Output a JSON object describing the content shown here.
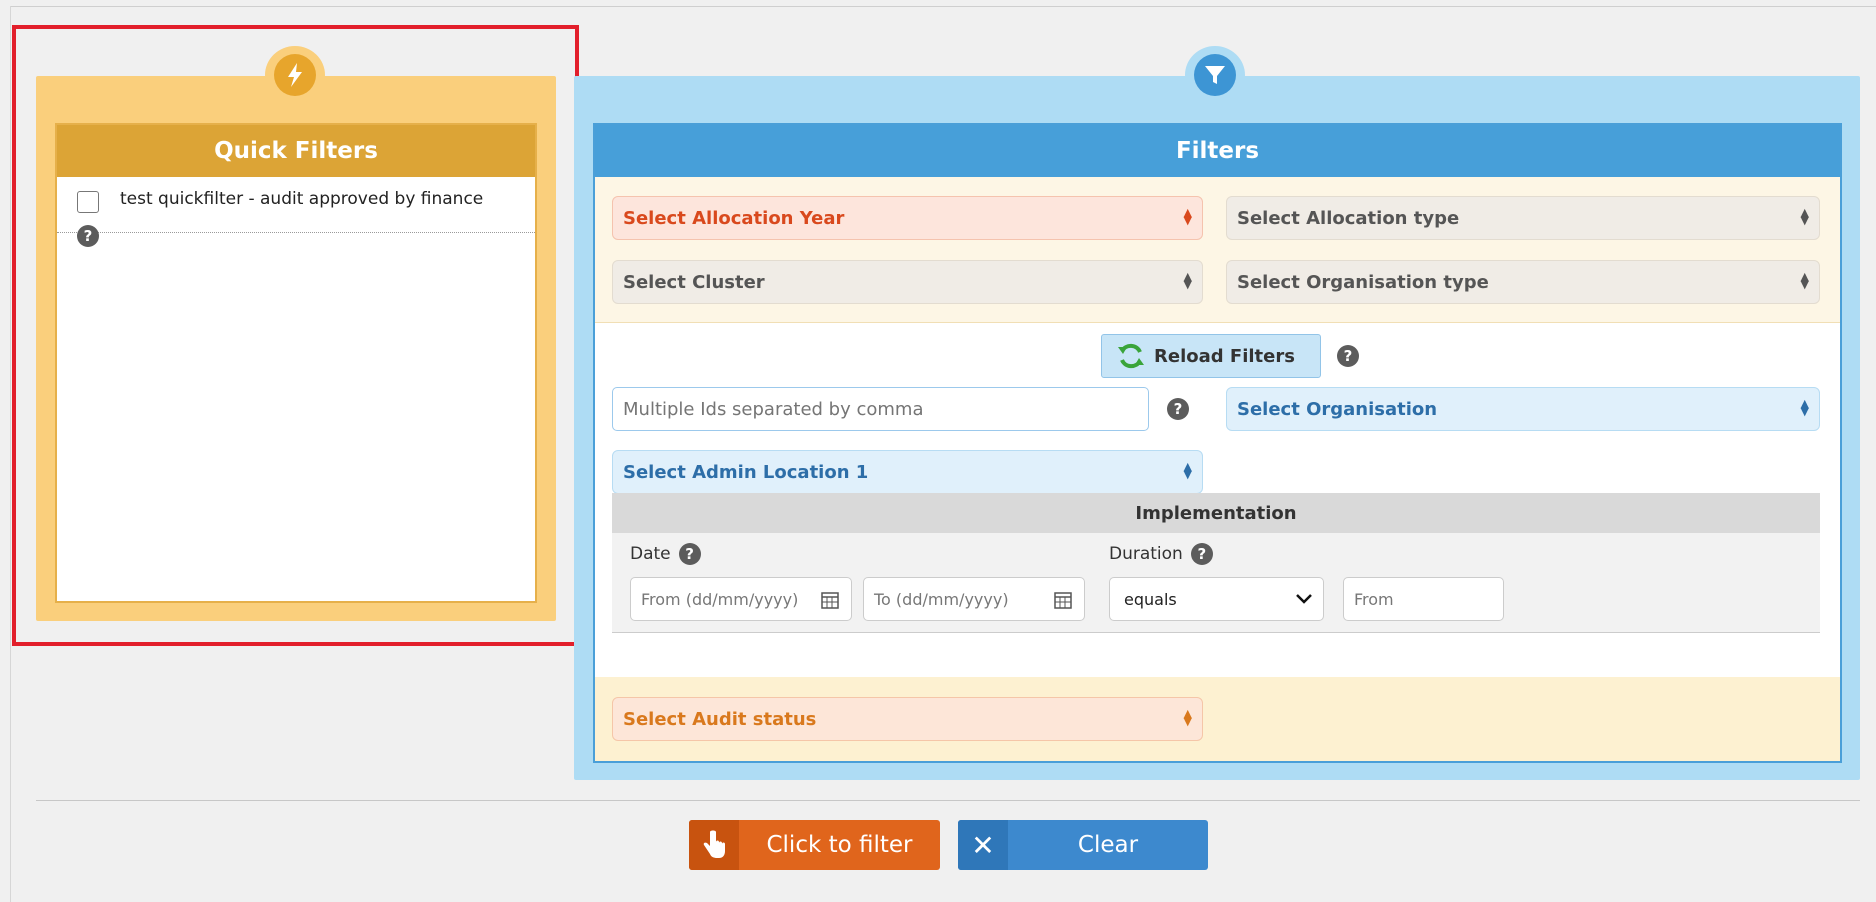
{
  "quick_filters": {
    "title": "Quick Filters",
    "items": [
      {
        "label": "test quickfilter - audit approved by finance",
        "checked": false
      }
    ]
  },
  "filters": {
    "title": "Filters",
    "allocation_year": "Select Allocation Year",
    "allocation_type": "Select Allocation type",
    "cluster": "Select Cluster",
    "organisation_type": "Select Organisation type",
    "reload_label": "Reload Filters",
    "ids_placeholder": "Multiple Ids separated by comma",
    "organisation": "Select Organisation",
    "admin_location": "Select Admin Location 1",
    "implementation": {
      "title": "Implementation",
      "date_label": "Date",
      "date_from_placeholder": "From (dd/mm/yyyy)",
      "date_to_placeholder": "To (dd/mm/yyyy)",
      "duration_label": "Duration",
      "duration_operator": "equals",
      "duration_from_placeholder": "From"
    },
    "audit_status": "Select Audit status"
  },
  "actions": {
    "filter_label": "Click to filter",
    "clear_label": "Clear"
  },
  "colors": {
    "quick_accent": "#dca436",
    "filter_accent": "#479fd9",
    "filter_button": "#e0651c",
    "clear_button": "#3d89ce",
    "highlight_frame": "#e21f2b"
  }
}
